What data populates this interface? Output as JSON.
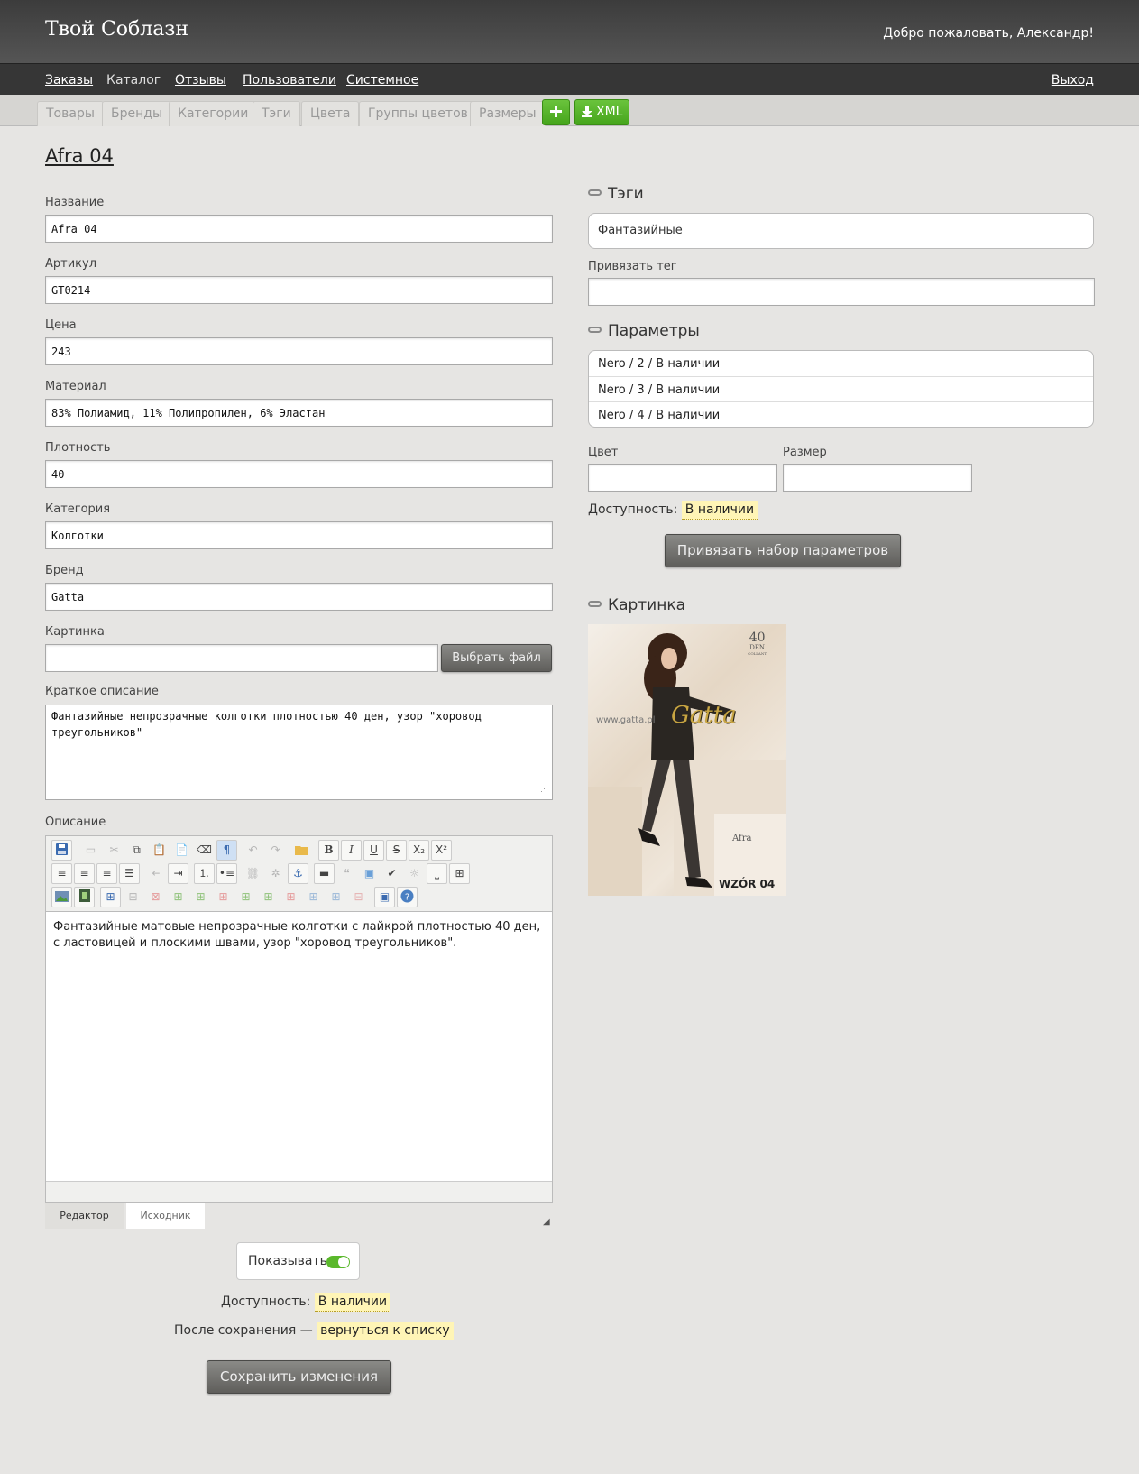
{
  "header": {
    "brand": "Твой Соблазн",
    "welcome": "Добро пожаловать, Александр!"
  },
  "nav": {
    "orders": "Заказы",
    "catalog": "Каталог",
    "reviews": "Отзывы",
    "users": "Пользователи",
    "system": "Системное",
    "logout": "Выход"
  },
  "subnav": {
    "tabs": [
      "Товары",
      "Бренды",
      "Категории",
      "Тэги",
      "Цвета",
      "Группы цветов",
      "Размеры"
    ],
    "add_icon": "plus-icon",
    "xml_label": "XML"
  },
  "product": {
    "title": "Afra 04",
    "fields": {
      "name_label": "Название",
      "name_value": "Afra 04",
      "sku_label": "Артикул",
      "sku_value": "GT0214",
      "price_label": "Цена",
      "price_value": "243",
      "material_label": "Материал",
      "material_value": "83% Полиамид, 11% Полипропилен, 6% Эластан",
      "density_label": "Плотность",
      "density_value": "40",
      "category_label": "Категория",
      "category_value": "Колготки",
      "brand_label": "Бренд",
      "brand_value": "Gatta",
      "image_label": "Картинка",
      "image_value": "",
      "choose_file": "Выбрать файл",
      "short_desc_label": "Краткое описание",
      "short_desc_value": "Фантазийные непрозрачные колготки плотностью 40 ден, узор \"хоровод треугольников\"",
      "desc_label": "Описание"
    },
    "editor": {
      "content": "Фантазийные матовые непрозрачные колготки с лайкрой плотностью 40 ден, с ластовицей и плоскими швами, узор \"хоровод треугольников\".",
      "tab_editor": "Редактор",
      "tab_source": "Исходник"
    },
    "show_label": "Показывать",
    "show_on": true,
    "availability_label": "Доступность:",
    "availability_value": "В наличии",
    "after_save_label": "После сохранения —",
    "after_save_value": "вернуться к списку",
    "save_button": "Сохранить изменения"
  },
  "tags": {
    "heading": "Тэги",
    "items": [
      "Фантазийные"
    ],
    "bind_label": "Привязать тег",
    "bind_value": ""
  },
  "params": {
    "heading": "Параметры",
    "rows": [
      "Nero / 2 / В наличии",
      "Nero / 3 / В наличии",
      "Nero / 4 / В наличии"
    ],
    "color_label": "Цвет",
    "color_value": "",
    "size_label": "Размер",
    "size_value": "",
    "availability_label": "Доступность:",
    "availability_value": "В наличии",
    "bind_button": "Привязать набор параметров"
  },
  "picture": {
    "heading": "Картинка",
    "den_number": "40",
    "den_text": "DEN",
    "den_sub": "COLLANT",
    "url": "www.gatta.pl",
    "logo": "Gatta",
    "model_name": "Afra",
    "pattern": "WZÓR 04"
  },
  "colors": {
    "accent_green": "#46a51c",
    "highlight": "#fff5b6",
    "dark_button": "#5f5e5b"
  }
}
